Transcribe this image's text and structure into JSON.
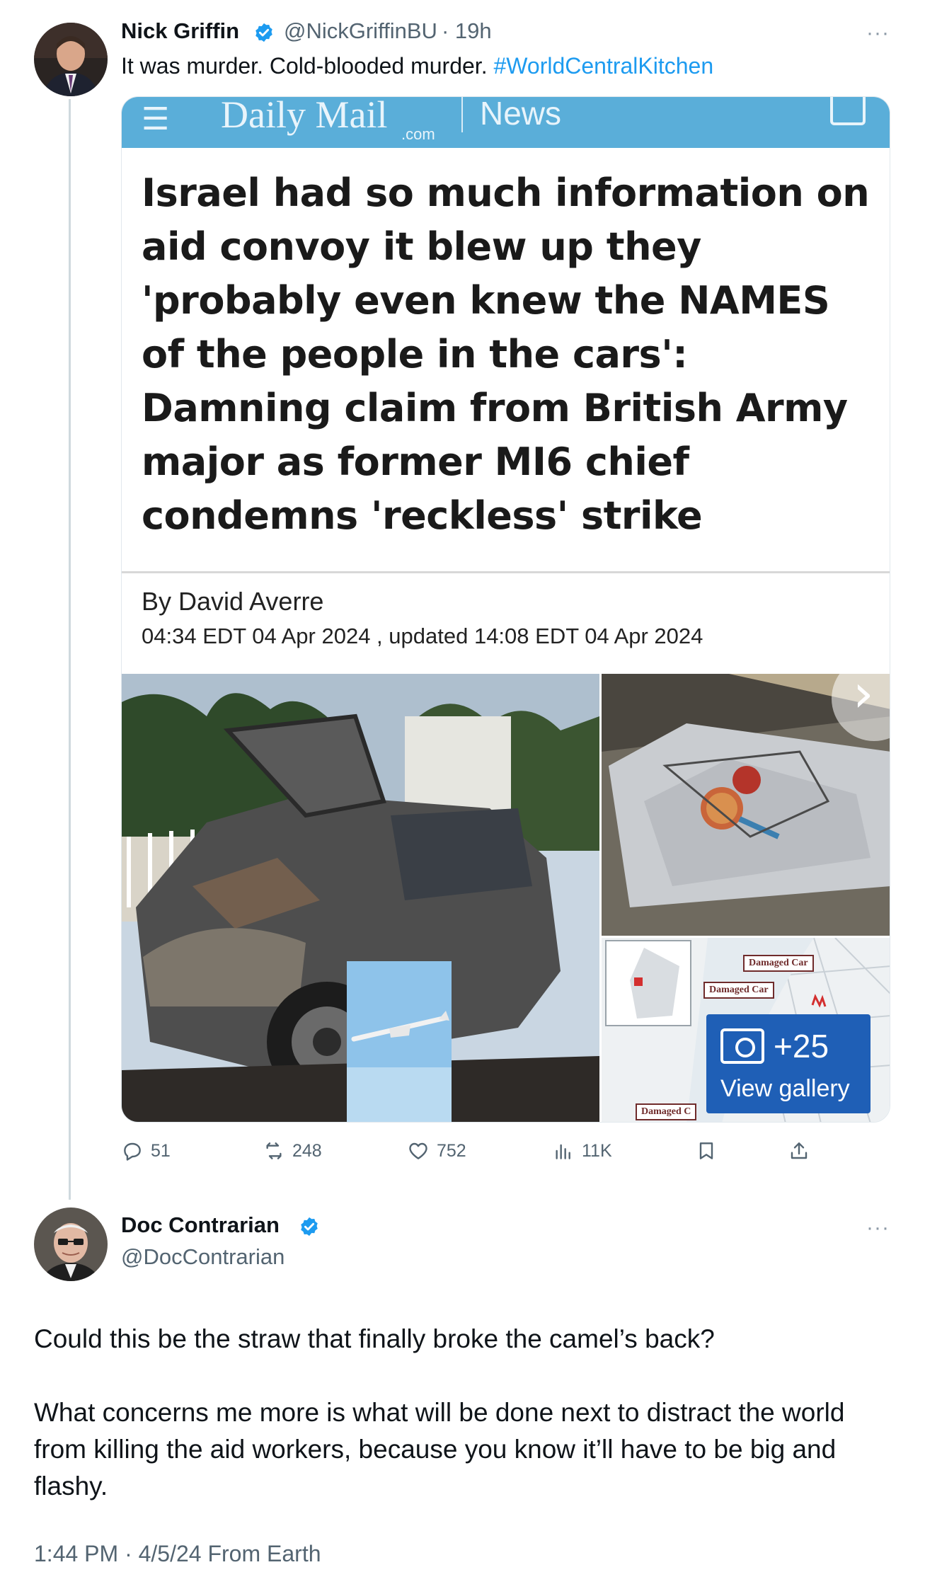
{
  "tweet1": {
    "name": "Nick Griffin",
    "handle": "@NickGriffinBU",
    "time": "· 19h",
    "text": "It was murder. Cold-blooded murder. ",
    "hashtag": "#WorldCentralKitchen",
    "more": "···",
    "card": {
      "masthead_brand": "Daily Mail",
      "masthead_com": ".com",
      "masthead_section": "News",
      "headline": "Israel had so much information on aid convoy it blew up they 'probably even knew the NAMES of the people in the cars': Damning claim from British Army major as former MI6 chief condemns 'reckless' strike",
      "byline": "By David Averre",
      "dateline": "04:34 EDT 04 Apr 2024 , updated 14:08 EDT 04 Apr 2024",
      "map_labels": [
        "Damaged Car",
        "Damaged Car",
        "Damaged C"
      ],
      "gallery_count": "+25",
      "gallery_label": "View gallery"
    },
    "actions": {
      "replies": "51",
      "reposts": "248",
      "likes": "752",
      "views": "11K"
    }
  },
  "tweet2": {
    "name": "Doc Contrarian",
    "handle": "@DocContrarian",
    "more": "···",
    "paragraphs": [
      "Could this be the straw that finally broke the camel’s back?",
      "What concerns me more is what will be done next to distract the world from killing the aid workers, because you know it’ll have to be big and flashy."
    ],
    "meta": "1:44 PM · 4/5/24 From Earth"
  },
  "colors": {
    "link": "#1d9bf0",
    "secondary_text": "#536471",
    "masthead": "#5aaed9",
    "gallery_button": "#1f5fb6"
  }
}
